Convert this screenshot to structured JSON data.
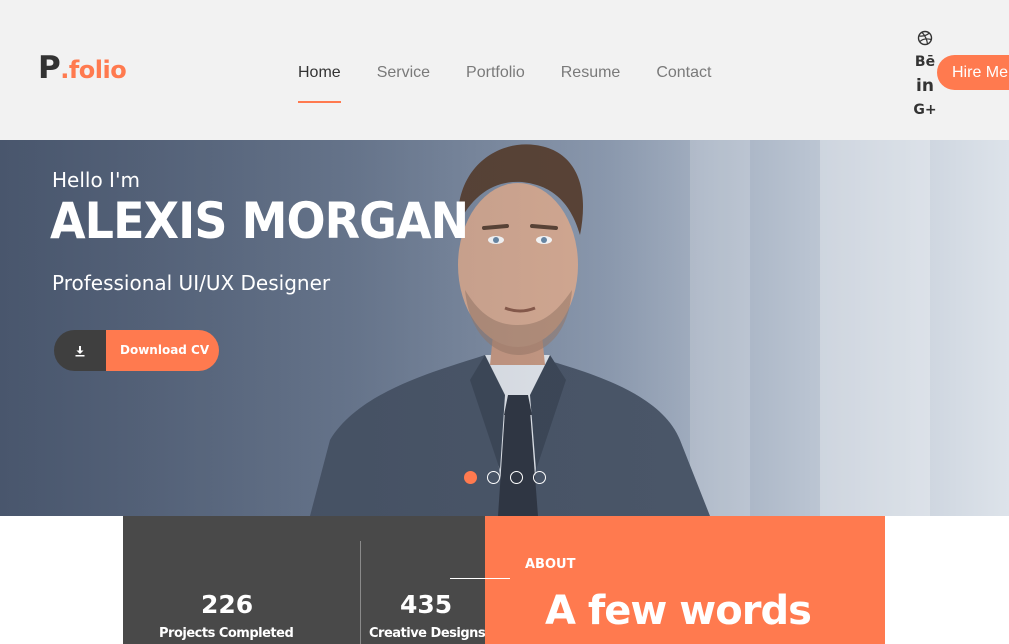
{
  "header": {
    "logo_main": "P",
    "logo_accent": ".folio",
    "nav": [
      {
        "label": "Home",
        "active": true
      },
      {
        "label": "Service",
        "active": false
      },
      {
        "label": "Portfolio",
        "active": false
      },
      {
        "label": "Resume",
        "active": false
      },
      {
        "label": "Contact",
        "active": false
      }
    ],
    "social": [
      {
        "icon": "dribbble-icon",
        "label": ""
      },
      {
        "icon": "behance-icon",
        "label": "Bē"
      },
      {
        "icon": "linkedin-icon",
        "label": "in"
      },
      {
        "icon": "google-plus-icon",
        "label": "G+"
      }
    ],
    "hire_label": "Hire Me"
  },
  "hero": {
    "greeting": "Hello I'm",
    "name": "ALEXIS MORGAN",
    "role": "Professional UI/UX Designer",
    "download_label": "Download CV",
    "download_icon": "download-icon",
    "slides_total": 4,
    "slide_active": 1
  },
  "stats": [
    {
      "value": "226",
      "label": "Projects Completed"
    },
    {
      "value": "435",
      "label": "Creative Designs"
    }
  ],
  "about": {
    "label": "ABOUT",
    "title": "A few words"
  },
  "colors": {
    "accent": "#ff7a4f",
    "dark": "#494949",
    "header_bg": "#f2f2f2",
    "text_dark": "#333333"
  }
}
